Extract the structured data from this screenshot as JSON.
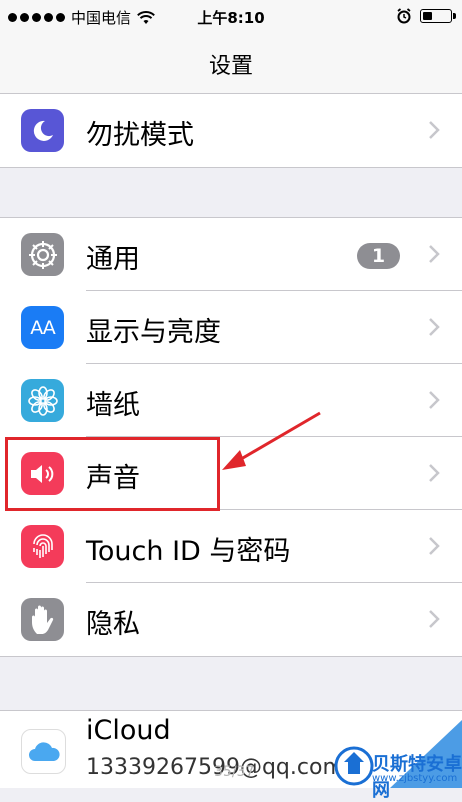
{
  "status_bar": {
    "carrier": "中国电信",
    "time": "上午8:10",
    "signal_bars": 5,
    "battery_level": 0.35
  },
  "nav": {
    "title": "设置"
  },
  "group1": [
    {
      "label": "勿扰模式",
      "icon": "moon-icon",
      "color": "#5856d6"
    }
  ],
  "group2": [
    {
      "label": "通用",
      "icon": "gear-icon",
      "color": "#8e8e93",
      "badge": "1"
    },
    {
      "label": "显示与亮度",
      "icon": "aa-icon",
      "icon_text": "AA",
      "color": "#1a7cf5"
    },
    {
      "label": "墙纸",
      "icon": "flower-icon",
      "color": "#36aadc"
    },
    {
      "label": "声音",
      "icon": "speaker-icon",
      "color": "#f43b5a",
      "highlighted": true
    },
    {
      "label": "Touch ID 与密码",
      "icon": "fingerprint-icon",
      "color": "#f43b5a"
    },
    {
      "label": "隐私",
      "icon": "hand-icon",
      "color": "#8e8e93"
    }
  ],
  "group3": {
    "label": "iCloud",
    "email": "13339267599@qq.com",
    "icon": "cloud-icon"
  },
  "page_counter": "35/37",
  "watermark": {
    "name": "贝斯特安卓网",
    "url": "www.zjbstyy.com"
  },
  "accent_color": "#e0262b"
}
